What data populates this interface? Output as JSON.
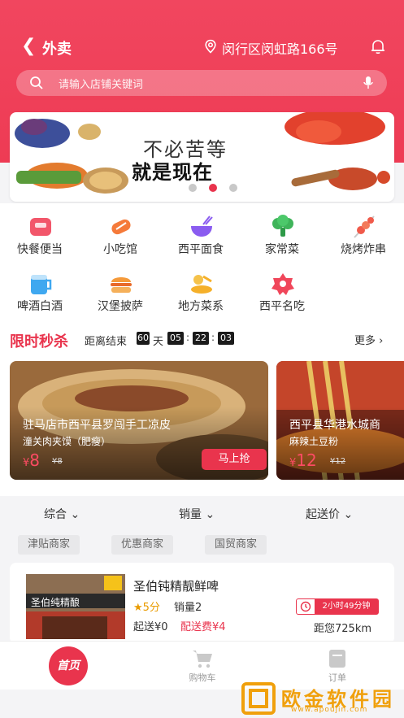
{
  "header": {
    "back_icon": "chevron-left-icon",
    "title": "外卖",
    "location_icon": "map-pin-icon",
    "location": "闵行区闵虹路166号",
    "bell_icon": "bell-icon"
  },
  "search": {
    "placeholder": "请输入店铺关键词",
    "search_icon": "search-icon",
    "mic_icon": "microphone-icon"
  },
  "banner": {
    "line1": "不必苦等",
    "line2": "就是现在",
    "dots_count": 3,
    "active_dot": 2
  },
  "categories": [
    {
      "label": "快餐便当",
      "icon": "bento-box-icon",
      "color": "#f2566a"
    },
    {
      "label": "小吃馆",
      "icon": "skewer-snack-icon",
      "color": "#f57a3a"
    },
    {
      "label": "西平面食",
      "icon": "noodle-bowl-icon",
      "color": "#8a5cf0"
    },
    {
      "label": "家常菜",
      "icon": "broccoli-icon",
      "color": "#3fb45a"
    },
    {
      "label": "烧烤炸串",
      "icon": "bbq-skewer-icon",
      "color": "#f05a4a"
    },
    {
      "label": "啤酒白酒",
      "icon": "beer-mug-icon",
      "color": "#3fa8f0"
    },
    {
      "label": "汉堡披萨",
      "icon": "burger-icon",
      "color": "#f59a3a"
    },
    {
      "label": "地方菜系",
      "icon": "local-dish-icon",
      "color": "#f5b02a"
    },
    {
      "label": "西平名吃",
      "icon": "flower-badge-icon",
      "color": "#f0465a"
    }
  ],
  "flash_sale": {
    "title": "限时秒杀",
    "ends_label": "距离结束",
    "days": "60",
    "day_unit": "天",
    "hours": "05",
    "minutes": "22",
    "seconds": "03",
    "more": "更多",
    "more_icon": "chevron-right-icon",
    "items": [
      {
        "shop": "驻马店市西平县罗闯手工凉皮",
        "product": "潼关肉夹馍（肥瘦）",
        "currency": "¥",
        "price": "8",
        "old_price": "¥8",
        "button": "马上抢"
      },
      {
        "shop": "西平县华港水城商",
        "product": "麻辣土豆粉",
        "currency": "¥",
        "price": "12",
        "old_price": "¥12"
      }
    ]
  },
  "sort": {
    "options": [
      "综合",
      "销量",
      "起送价"
    ],
    "dropdown_icon": "chevron-down-icon"
  },
  "tags": [
    "津贴商家",
    "优惠商家",
    "国贸商家"
  ],
  "shop": {
    "name": "圣伯钝精靓鲜啤",
    "image_sign": "圣伯纯精酿",
    "rating": "5分",
    "rating_icon": "star-icon",
    "sales": "销量2",
    "min_order": "起送¥0",
    "delivery_fee": "配送费¥4",
    "time_icon": "clock-icon",
    "time": "2小时49分钟",
    "distance": "距您725km"
  },
  "tabbar": {
    "home": "首页",
    "cart": "购物车",
    "cart_icon": "shopping-cart-icon",
    "orders": "订单",
    "orders_icon": "order-icon"
  },
  "watermark": {
    "text": "欧金软件园",
    "url": "www.apoujin.com"
  }
}
